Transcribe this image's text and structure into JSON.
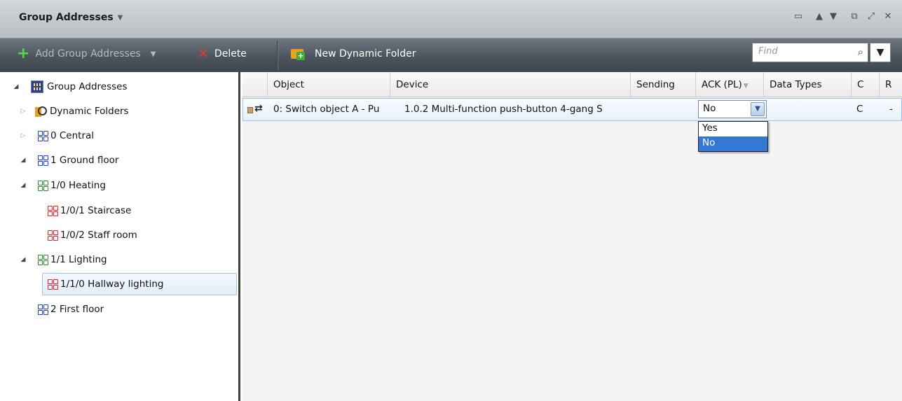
{
  "titlebar": {
    "title": "Group Addresses"
  },
  "toolbar": {
    "add_label": "Add Group Addresses",
    "delete_label": "Delete",
    "new_dynamic_folder_label": "New Dynamic Folder",
    "find_placeholder": "Find"
  },
  "tree": {
    "items": [
      {
        "label": "Group Addresses",
        "level": 0,
        "expanded": true,
        "icon": "root-grid-icon"
      },
      {
        "label": "Dynamic Folders",
        "level": 1,
        "expanded": false,
        "icon": "dynamic-folder-icon"
      },
      {
        "label": "0 Central",
        "level": 1,
        "expanded": false,
        "icon": "main-group-icon"
      },
      {
        "label": "1 Ground floor",
        "level": 1,
        "expanded": true,
        "icon": "main-group-icon"
      },
      {
        "label": "1/0 Heating",
        "level": 2,
        "expanded": true,
        "icon": "middle-group-icon"
      },
      {
        "label": "1/0/1 Staircase",
        "level": 3,
        "icon": "group-address-icon"
      },
      {
        "label": "1/0/2 Staff room",
        "level": 3,
        "icon": "group-address-icon"
      },
      {
        "label": "1/1 Lighting",
        "level": 2,
        "expanded": true,
        "icon": "middle-group-icon"
      },
      {
        "label": "1/1/0 Hallway lighting",
        "level": 3,
        "icon": "group-address-icon",
        "selected": true
      },
      {
        "label": "2 First floor",
        "level": 1,
        "icon": "main-group-icon"
      }
    ]
  },
  "grid": {
    "columns": [
      "Object",
      "Device",
      "Sending",
      "ACK (PL)",
      "Data Types",
      "C",
      "R"
    ],
    "rows": [
      {
        "object": "0: Switch object A - Pu",
        "device": "1.0.2  Multi-function push-button 4-gang S",
        "sending": "",
        "ack": "No",
        "data_types": "",
        "c": "C",
        "r": "-"
      }
    ],
    "ack_dropdown": {
      "value": "No",
      "options": [
        "Yes",
        "No"
      ],
      "selected": "No"
    }
  },
  "colors": {
    "accent": "#3478d4",
    "toolbar_dark": "#4c545d"
  }
}
